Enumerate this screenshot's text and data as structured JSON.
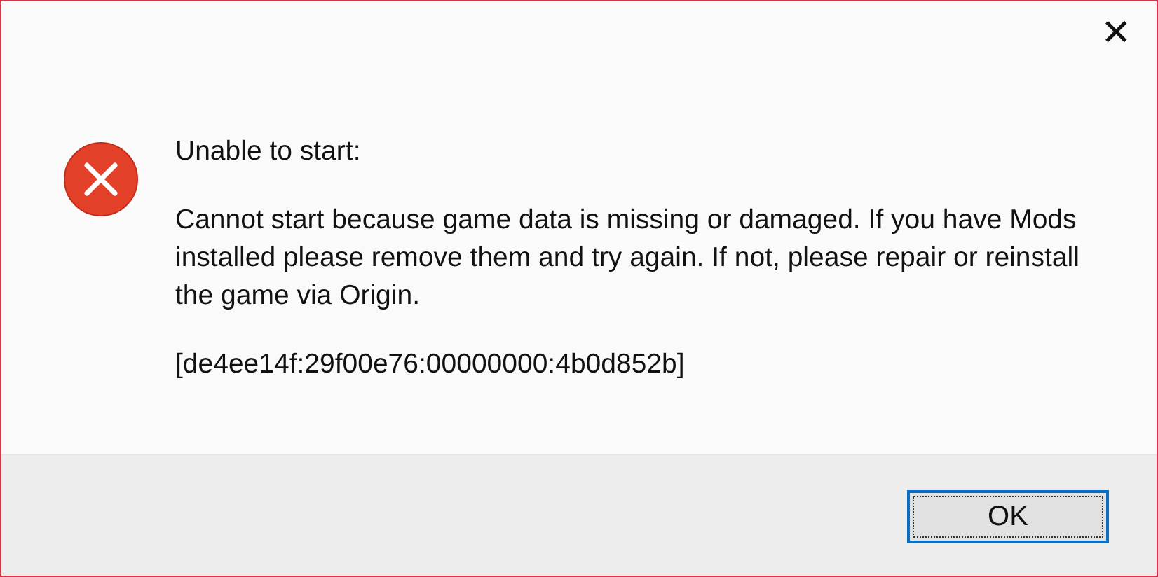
{
  "window": {
    "close_label": "✕"
  },
  "message": {
    "kind": "error",
    "heading": "Unable to start:",
    "body": "Cannot start because game data is missing or damaged. If you have Mods installed please remove them and try again.  If not, please repair or reinstall the game via Origin.",
    "code": "[de4ee14f:29f00e76:00000000:4b0d852b]"
  },
  "buttons": [
    {
      "label": "OK",
      "focused": true
    }
  ]
}
